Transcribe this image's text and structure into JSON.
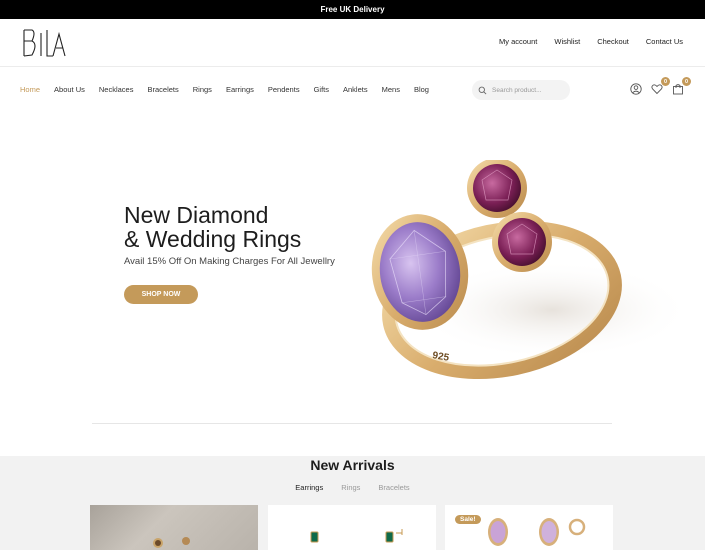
{
  "topbar": {
    "text": "Free UK Delivery"
  },
  "header": {
    "logo_text": "BIA",
    "links": [
      "My account",
      "Wishlist",
      "Checkout",
      "Contact Us"
    ]
  },
  "nav": {
    "items": [
      "Home",
      "About Us",
      "Necklaces",
      "Bracelets",
      "Rings",
      "Earrings",
      "Pendents",
      "Gifts",
      "Anklets",
      "Mens",
      "Blog"
    ],
    "active": "Home",
    "search_placeholder": "Search product...",
    "wishlist_count": "0",
    "cart_count": "0",
    "icons": [
      "search-icon",
      "user-icon",
      "heart-icon",
      "bag-icon"
    ]
  },
  "hero": {
    "title_line1": "New Diamond",
    "title_line2": "& Wedding Rings",
    "subtitle": "Avail 15% Off On Making Charges For All Jewellry",
    "button": "SHOP NOW",
    "ring_stamp": "925"
  },
  "arrivals": {
    "title": "New Arrivals",
    "tabs": [
      "Earrings",
      "Rings",
      "Bracelets"
    ],
    "active_tab": "Earrings",
    "sale_badge": "Sale!"
  },
  "colors": {
    "accent": "#c49a5a",
    "topbar": "#000000",
    "section_bg": "#f2f2f2"
  }
}
